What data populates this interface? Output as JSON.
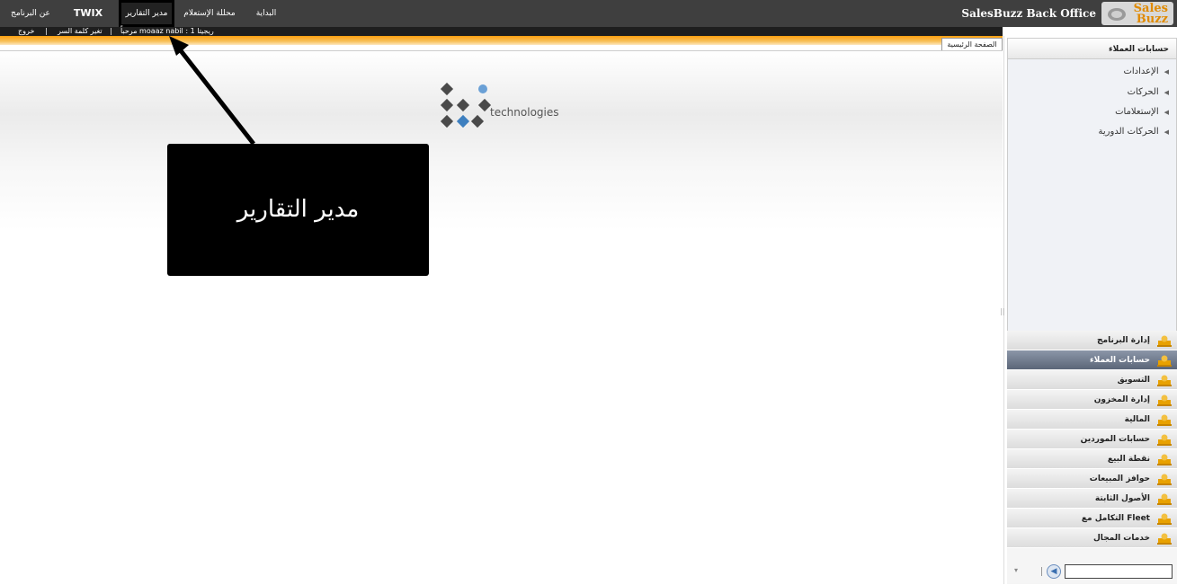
{
  "topbar": {
    "menu": [
      {
        "label": "عن البرنامج"
      },
      {
        "label": "TWIX"
      },
      {
        "label": "مدير التقارير"
      },
      {
        "label": "محللة الإستعلام"
      },
      {
        "label": "البداية"
      }
    ],
    "app_title": "SalesBuzz Back Office",
    "logo_line1": "Sales",
    "logo_line2": "Buzz"
  },
  "subbar": {
    "logout": "خروج",
    "change_password": "تغير كلمة السر",
    "user_info": "مرحباً moaaz nabil : ريجيتا 1"
  },
  "tabs": {
    "home": "الصفحة الرئيسية"
  },
  "brand_logo_text": "technologies",
  "callout": {
    "text": "مدير التقارير"
  },
  "sidebar": {
    "title": "حسابات العملاء",
    "tree": [
      {
        "label": "الإعدادات"
      },
      {
        "label": "الحركات"
      },
      {
        "label": "الإستعلامات"
      },
      {
        "label": "الحركات الدورية"
      }
    ],
    "nav": [
      {
        "label": "إدارة البرنامج"
      },
      {
        "label": "حسابات العملاء"
      },
      {
        "label": "التسويق"
      },
      {
        "label": "إدارة المخزون"
      },
      {
        "label": "المالية"
      },
      {
        "label": "حسابات الموردين"
      },
      {
        "label": "نقطة البيع"
      },
      {
        "label": "حوافز المبيعات"
      },
      {
        "label": "الأصول الثابتة"
      },
      {
        "label": "التكامل مع Fleet"
      },
      {
        "label": "خدمات المجال"
      }
    ],
    "active_nav": "حسابات العملاء"
  },
  "colors": {
    "topbar": "#3f3f3f",
    "accent_orange": "#ff9f10",
    "active_nav": "#5b6678"
  }
}
